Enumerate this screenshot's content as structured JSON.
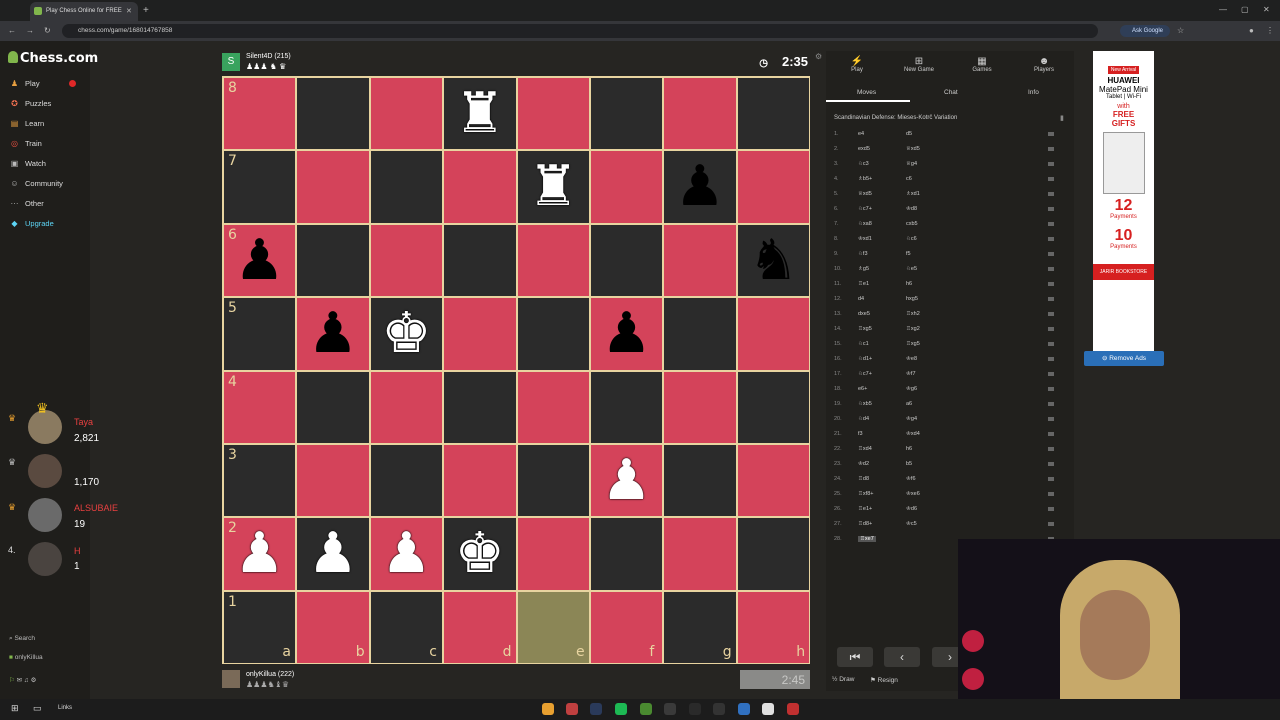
{
  "browser": {
    "tab_title": "Play Chess Online for FREE",
    "url": "chess.com/game/168014767858",
    "ask_google": "Ask Google"
  },
  "sidebar": {
    "logo": "Chess.com",
    "items": [
      {
        "label": "Play",
        "icon": "♟"
      },
      {
        "label": "Puzzles",
        "icon": "✪"
      },
      {
        "label": "Learn",
        "icon": "▤"
      },
      {
        "label": "Train",
        "icon": "◎"
      },
      {
        "label": "Watch",
        "icon": "▣"
      },
      {
        "label": "Community",
        "icon": "☺"
      },
      {
        "label": "Other",
        "icon": "···"
      },
      {
        "label": "Upgrade",
        "icon": "◆"
      }
    ],
    "search": "Search",
    "user": "onlyKillua"
  },
  "game": {
    "top_player": "Silent4D (215)",
    "top_avatar_letter": "S",
    "top_clock": "2:35",
    "bottom_player": "onlyKillua (222)",
    "bottom_clock": "2:45"
  },
  "board": {
    "ranks": [
      "8",
      "7",
      "6",
      "5",
      "4",
      "3",
      "2",
      "1"
    ],
    "files": [
      "a",
      "b",
      "c",
      "d",
      "e",
      "f",
      "g",
      "h"
    ],
    "pieces": [
      {
        "sq": "d8",
        "glyph": "♜",
        "color": "w"
      },
      {
        "sq": "e7",
        "glyph": "♜",
        "color": "w"
      },
      {
        "sq": "g7",
        "glyph": "♟",
        "color": "b"
      },
      {
        "sq": "a6",
        "glyph": "♟",
        "color": "b"
      },
      {
        "sq": "h6",
        "glyph": "♞",
        "color": "b"
      },
      {
        "sq": "b5",
        "glyph": "♟",
        "color": "b"
      },
      {
        "sq": "c5",
        "glyph": "♚",
        "color": "w"
      },
      {
        "sq": "f5",
        "glyph": "♟",
        "color": "b"
      },
      {
        "sq": "f3",
        "glyph": "♟",
        "color": "w"
      },
      {
        "sq": "a2",
        "glyph": "♟",
        "color": "w"
      },
      {
        "sq": "b2",
        "glyph": "♟",
        "color": "w"
      },
      {
        "sq": "c2",
        "glyph": "♟",
        "color": "w"
      },
      {
        "sq": "d2",
        "glyph": "♚",
        "color": "w"
      }
    ],
    "highlight": "e1"
  },
  "panel": {
    "tabs": [
      "Play",
      "New Game",
      "Games",
      "Players"
    ],
    "subtabs": [
      "Moves",
      "Chat",
      "Info"
    ],
    "opening": "Scandinavian Defense: Mieses-Kotrč Variation",
    "moves": [
      [
        "1.",
        "e4",
        "d5"
      ],
      [
        "2.",
        "exd5",
        "♕xd5"
      ],
      [
        "3.",
        "♘c3",
        "♕g4"
      ],
      [
        "4.",
        "♗b5+",
        "c6"
      ],
      [
        "5.",
        "♕xd5",
        "♗xd1"
      ],
      [
        "6.",
        "♘c7+",
        "♔d8"
      ],
      [
        "7.",
        "♘xa8",
        "cxb5"
      ],
      [
        "8.",
        "♔xd1",
        "♘c6"
      ],
      [
        "9.",
        "♘f3",
        "f5"
      ],
      [
        "10.",
        "♗g5",
        "♘e5"
      ],
      [
        "11.",
        "♖e1",
        "h6"
      ],
      [
        "12.",
        "d4",
        "hxg5"
      ],
      [
        "13.",
        "dxe5",
        "♖xh2"
      ],
      [
        "14.",
        "♖xg5",
        "♖xg2"
      ],
      [
        "15.",
        "♘c1",
        "♖xg5"
      ],
      [
        "16.",
        "♘d1+",
        "♔e8"
      ],
      [
        "17.",
        "♘c7+",
        "♔f7"
      ],
      [
        "18.",
        "e6+",
        "♔g6"
      ],
      [
        "19.",
        "♘xb5",
        "a6"
      ],
      [
        "20.",
        "♘d4",
        "♔g4"
      ],
      [
        "21.",
        "f3",
        "♔xd4"
      ],
      [
        "22.",
        "♖xd4",
        "h6"
      ],
      [
        "23.",
        "♔d2",
        "b5"
      ],
      [
        "24.",
        "♖d8",
        "♔f6"
      ],
      [
        "25.",
        "♖xf8+",
        "♔xe6"
      ],
      [
        "26.",
        "♖e1+",
        "♔d6"
      ],
      [
        "27.",
        "♖d8+",
        "♔c5"
      ],
      [
        "28.",
        "♖xe7",
        ""
      ]
    ],
    "controls": [
      "⏮",
      "‹",
      "›"
    ],
    "draw": "Draw",
    "resign": "Resign"
  },
  "ad": {
    "tag": "New Arrival",
    "brand": "HUAWEI",
    "product": "MatePad Mini",
    "desc": "Tablet | Wi-Fi",
    "with": "with",
    "gifts": "FREE GIFTS",
    "p1": "12",
    "p2": "10",
    "payments": "Payments",
    "store": "JARIR BOOKSTORE",
    "remove": "Remove Ads"
  },
  "viewers": [
    {
      "rank": "",
      "name": "Taya",
      "score": "2,821"
    },
    {
      "rank": "",
      "name": "",
      "score": "1,170"
    },
    {
      "rank": "",
      "name": "ALSUBAIE",
      "score": "19"
    },
    {
      "rank": "4.",
      "name": "H",
      "score": "1"
    }
  ],
  "taskbar": {
    "links": "Links"
  }
}
